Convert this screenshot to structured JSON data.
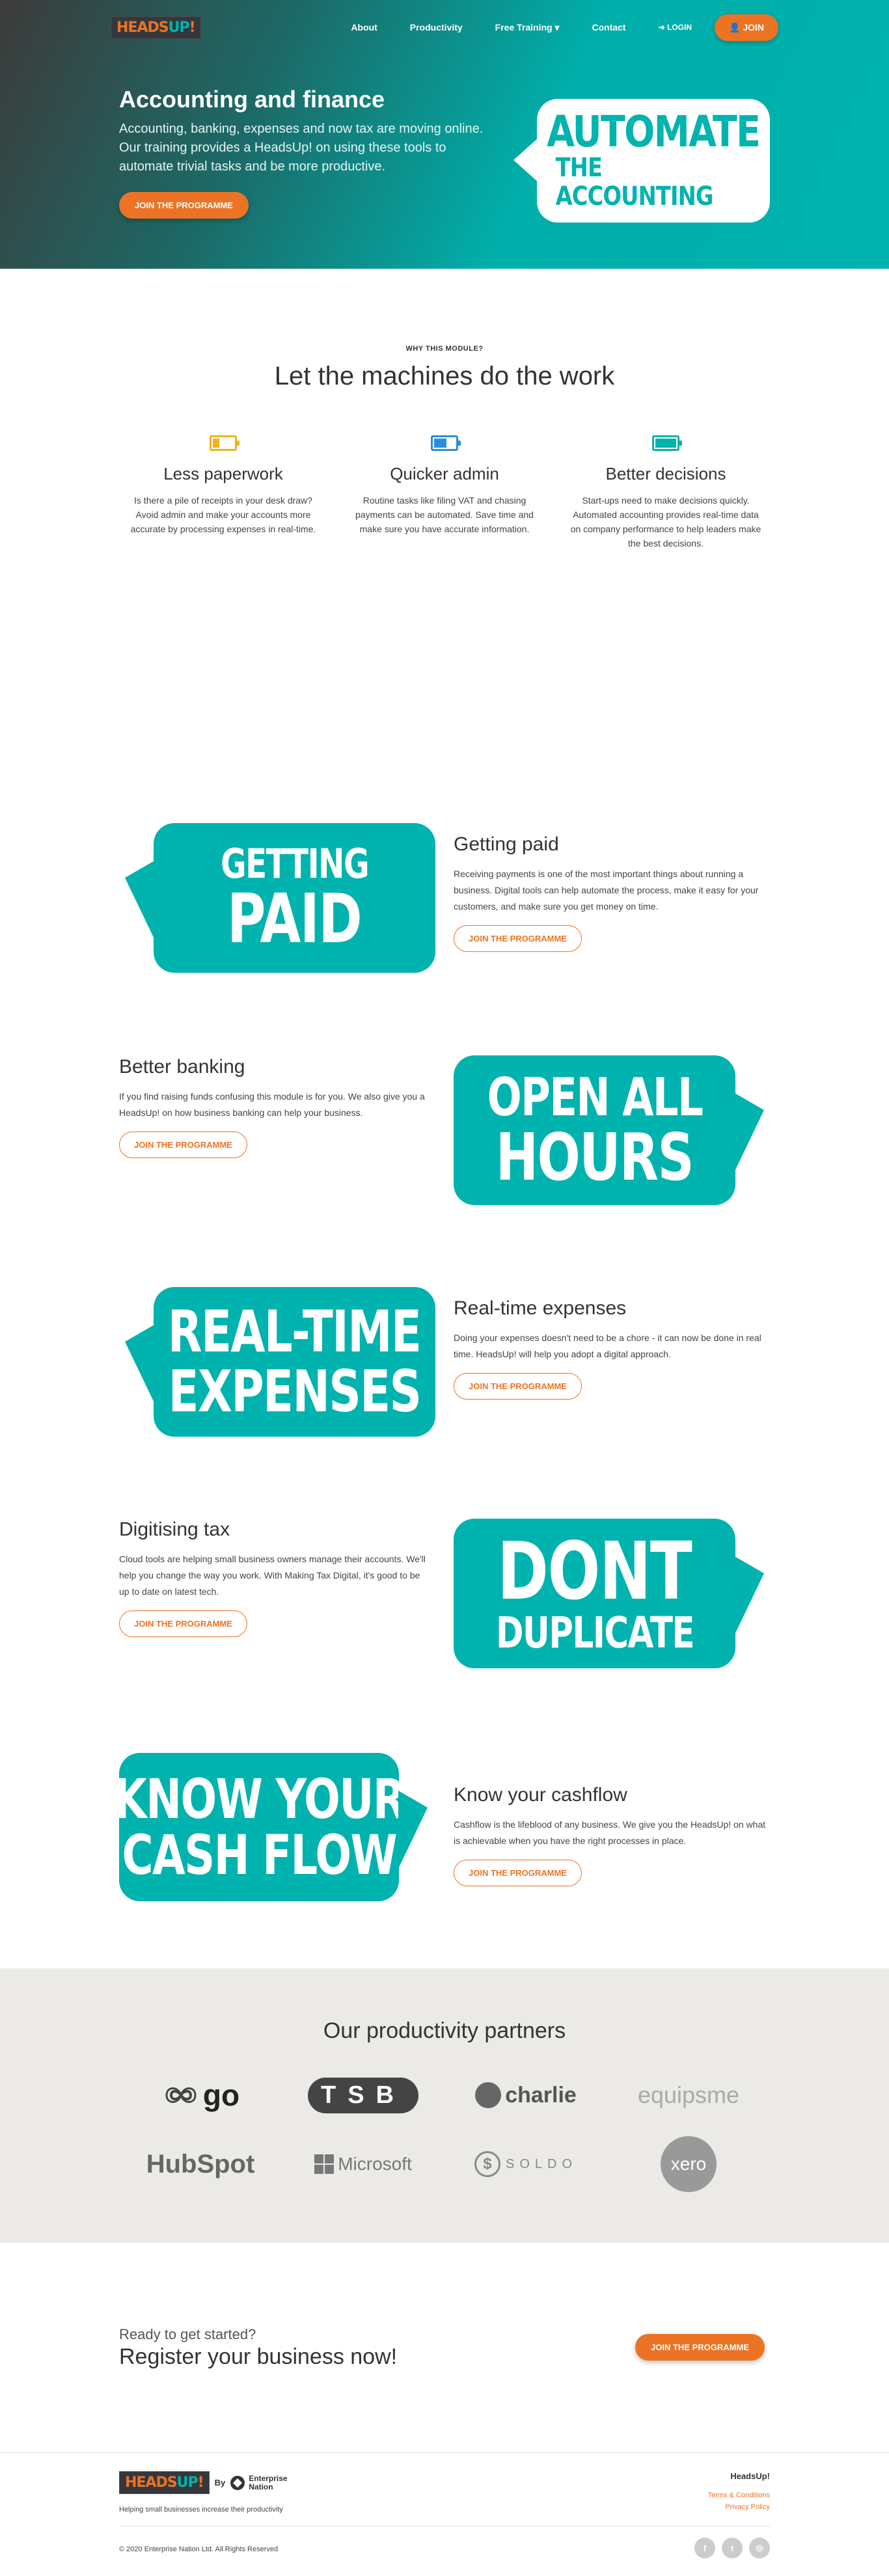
{
  "nav": {
    "logo": {
      "part1": "HEADS",
      "part2": "UP",
      "part3": "!"
    },
    "links": [
      "About",
      "Productivity",
      "Free Training ▾",
      "Contact"
    ],
    "login": "➜ LOGIN",
    "join": "👤 JOIN"
  },
  "hero": {
    "title": "Accounting and finance",
    "text": "Accounting, banking, expenses and now tax are moving online. Our training provides a HeadsUp! on using these tools to automate trivial tasks and be more productive.",
    "button": "JOIN THE PROGRAMME",
    "bubble_line1": "AUTOMATE",
    "bubble_line2": "THE ACCOUNTING"
  },
  "why": {
    "eyebrow": "WHY THIS MODULE?",
    "title": "Let the machines do the work",
    "features": [
      {
        "title": "Less paperwork",
        "text": "Is there a pile of receipts in your desk draw? Avoid admin and make your accounts more accurate by processing expenses in real-time.",
        "battery_color": "#f1b21a",
        "battery_level": 0.3
      },
      {
        "title": "Quicker admin",
        "text": "Routine tasks like filing VAT and chasing payments can be automated. Save time and make sure you have accurate information.",
        "battery_color": "#2b8ee0",
        "battery_level": 0.6
      },
      {
        "title": "Better decisions",
        "text": "Start-ups need to make decisions quickly. Automated accounting provides real-time data on company performance to help leaders make the best decisions.",
        "battery_color": "#00b3ae",
        "battery_level": 1.0
      }
    ]
  },
  "modules": [
    {
      "bubble": [
        "GETTING",
        "PAID"
      ],
      "title": "Getting paid",
      "text": "Receiving payments is one of the most important things about running a business. Digital tools can help automate the process, make it easy for your customers, and make sure you get money on time.",
      "button": "JOIN THE PROGRAMME"
    },
    {
      "bubble": [
        "OPEN ALL",
        "HOURS"
      ],
      "title": "Better banking",
      "text": "If you find raising funds confusing this module is for you. We also give you a HeadsUp! on how business banking can help your business.",
      "button": "JOIN THE PROGRAMME"
    },
    {
      "bubble": [
        "REAL-TIME",
        "EXPENSES"
      ],
      "title": "Real-time expenses",
      "text": "Doing your expenses doesn't need to be a chore - it can now be done in real time. HeadsUp! will help you adopt a digital approach.",
      "button": "JOIN THE PROGRAMME"
    },
    {
      "bubble": [
        "DONT",
        "DUPLICATE"
      ],
      "title": "Digitising tax",
      "text": "Cloud tools are helping small business owners manage their accounts. We'll help you change the way you work. With Making Tax Digital, it's good to be up to date on latest tech.",
      "button": "JOIN THE PROGRAMME"
    },
    {
      "bubble": [
        "KNOW YOUR",
        "CASH FLOW"
      ],
      "title": "Know your cashflow",
      "text": "Cashflow is the lifeblood of any business. We give you the HeadsUp! on what is achievable when you have the right processes in place.",
      "button": "JOIN THE PROGRAMME"
    }
  ],
  "partners": {
    "title": "Our productivity partners",
    "logos": [
      "go",
      "TSB",
      "charlie",
      "equipsme",
      "HubSpot",
      "Microsoft",
      "SOLDO",
      "xero"
    ]
  },
  "cta": {
    "small": "Ready to get started?",
    "big": "Register your business now!",
    "button": "JOIN THE PROGRAMME"
  },
  "footer": {
    "by": "By",
    "enterprise_line1": "Enterprise",
    "enterprise_line2": "Nation",
    "tagline": "Helping small businesses increase their productivity",
    "brand": "HeadsUp!",
    "links": [
      "Terms & Conditions",
      "Privacy Policy"
    ],
    "copyright": "© 2020 Enterprise Nation Ltd. All Rights Reserved",
    "social": [
      "f",
      "t",
      "◎"
    ]
  }
}
